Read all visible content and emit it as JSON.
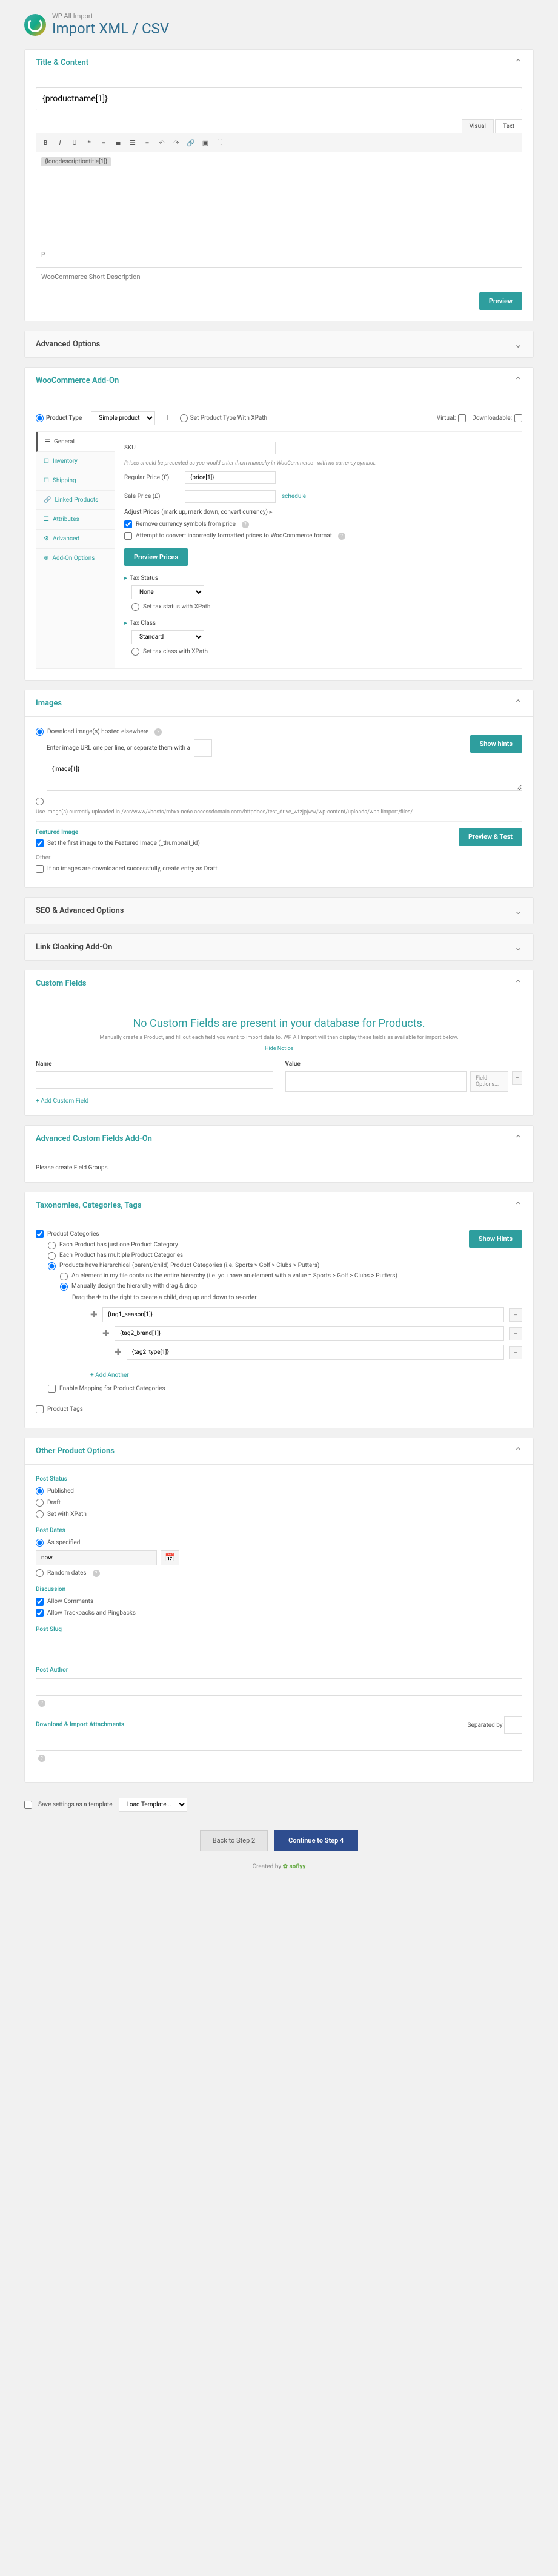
{
  "header": {
    "sub": "WP All Import",
    "title": "Import XML / CSV"
  },
  "titleContent": {
    "title": "Title & Content",
    "titleValue": "{productname[1]}",
    "tabs": {
      "visual": "Visual",
      "text": "Text"
    },
    "bodyTag": "{longdescriptiontitle[1]}",
    "status": "P",
    "shortDesc": "WooCommerce Short Description",
    "preview": "Preview"
  },
  "advOptions": {
    "title": "Advanced Options"
  },
  "woo": {
    "title": "WooCommerce Add-On",
    "productType": "Product Type",
    "productTypeVal": "Simple product",
    "setXpath": "Set Product Type With XPath",
    "virtual": "Virtual:",
    "downloadable": "Downloadable:",
    "tabs": {
      "general": "General",
      "inventory": "Inventory",
      "shipping": "Shipping",
      "linked": "Linked Products",
      "attributes": "Attributes",
      "advanced": "Advanced",
      "addon": "Add-On Options"
    },
    "sku": "SKU",
    "priceHint": "Prices should be presented as you would enter them manually in WooCommerce - with no currency symbol.",
    "regPrice": "Regular Price (£)",
    "regPriceVal": "{price[1]}",
    "salePrice": "Sale Price (£)",
    "schedule": "schedule",
    "adjust": "Adjust Prices (mark up, mark down, convert currency)",
    "removeCurrency": "Remove currency symbols from price",
    "convertPrices": "Attempt to convert incorrectly formatted prices to WooCommerce format",
    "previewPrices": "Preview Prices",
    "taxStatus": "Tax Status",
    "taxStatusVal": "None",
    "taxXpath": "Set tax status with XPath",
    "taxClass": "Tax Class",
    "taxClassVal": "Standard",
    "taxClassXpath": "Set tax class with XPath"
  },
  "images": {
    "title": "Images",
    "downloadElsewhere": "Download image(s) hosted elsewhere",
    "enterUrl": "Enter image URL one per line, or separate them with a",
    "imageVal": "{image[1]}",
    "uploadNote": "Use image(s) currently uploaded in /var/www/vhosts/mbxx-nc6c.accessdomain.com/httpdocs/test_drive_wtzjpjww/wp-content/uploads/wpallimport/files/",
    "featured": "Featured Image",
    "setFirst": "Set the first image to the Featured Image (_thumbnail_id)",
    "other": "Other",
    "noImages": "If no images are downloaded successfully, create entry as Draft.",
    "showHints": "Show hints",
    "previewTest": "Preview & Test"
  },
  "seo": {
    "title": "SEO & Advanced Options"
  },
  "cloaking": {
    "title": "Link Cloaking Add-On"
  },
  "cf": {
    "title": "Custom Fields",
    "message": "No Custom Fields are present in your database for Products.",
    "sub": "Manually create a Product, and fill out each field you want to import data to. WP All Import will then display these fields as available for import below.",
    "hide": "Hide Notice",
    "name": "Name",
    "value": "Value",
    "options": "Field Options...",
    "add": "Add Custom Field"
  },
  "acf": {
    "title": "Advanced Custom Fields Add-On",
    "msg": "Please create Field Groups."
  },
  "tax": {
    "title": "Taxonomies, Categories, Tags",
    "productCats": "Product Categories",
    "showHints": "Show Hints",
    "opt1": "Each Product has just one Product Category",
    "opt2": "Each Product has multiple Product Categories",
    "opt3": "Products have hierarchical (parent/child) Product Categories (i.e. Sports > Golf > Clubs > Putters)",
    "sub1": "An element in my file contains the entire hierarchy (i.e. you have an element with a value = Sports > Golf > Clubs > Putters)",
    "sub2": "Manually design the hierarchy with drag & drop",
    "dragHint": "Drag the ✚ to the right to create a child, drag up and down to re-order.",
    "items": [
      "{tag1_season[1]}",
      "{tag2_brand[1]}",
      "{tag2_type[1]}"
    ],
    "addAnother": "Add Another",
    "enableMapping": "Enable Mapping for Product Categories",
    "productTags": "Product Tags"
  },
  "other": {
    "title": "Other Product Options",
    "postStatus": "Post Status",
    "published": "Published",
    "draft": "Draft",
    "setXpath": "Set with XPath",
    "postDates": "Post Dates",
    "asSpecified": "As specified",
    "dateVal": "now",
    "randomDates": "Random dates",
    "discussion": "Discussion",
    "allowComments": "Allow Comments",
    "allowTrackbacks": "Allow Trackbacks and Pingbacks",
    "postSlug": "Post Slug",
    "postAuthor": "Post Author",
    "download": "Download & Import Attachments",
    "sepBy": "Separated by"
  },
  "footer": {
    "saveTemplate": "Save settings as a template",
    "loadTemplate": "Load Template...",
    "back": "Back to Step 2",
    "continue": "Continue to Step 4",
    "credits": "Created by"
  }
}
